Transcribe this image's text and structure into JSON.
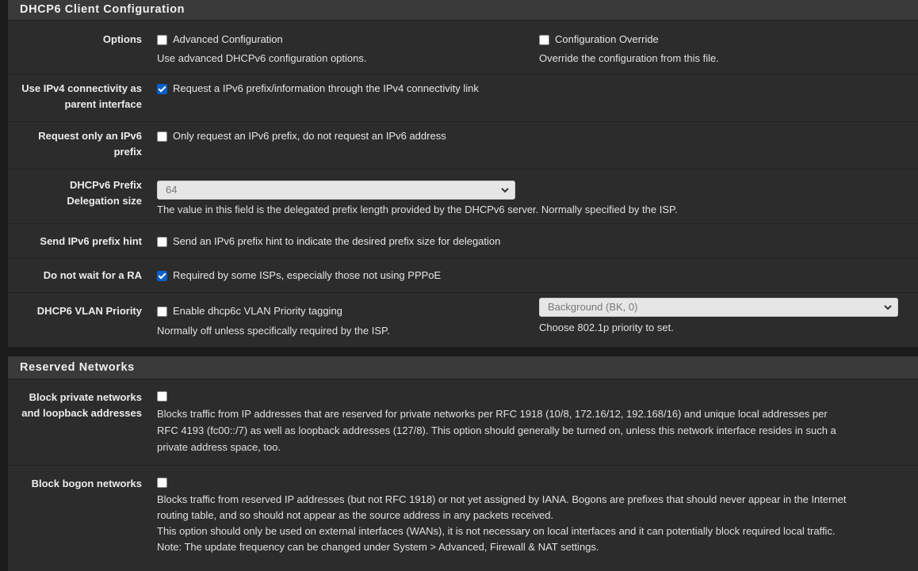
{
  "dhcp6": {
    "title": "DHCP6 Client Configuration",
    "options": {
      "label": "Options",
      "advanced": {
        "label": "Advanced Configuration",
        "checked": false,
        "help": "Use advanced DHCPv6 configuration options."
      },
      "override": {
        "label": "Configuration Override",
        "checked": false,
        "help": "Override the configuration from this file."
      }
    },
    "use_ipv4": {
      "label_line1": "Use IPv4 connectivity as",
      "label_line2": "parent interface",
      "text": "Request a IPv6 prefix/information through the IPv4 connectivity link",
      "checked": true
    },
    "request_only": {
      "label_line1": "Request only an IPv6",
      "label_line2": "prefix",
      "text": "Only request an IPv6 prefix, do not request an IPv6 address",
      "checked": false
    },
    "prefix_size": {
      "label_line1": "DHCPv6 Prefix",
      "label_line2": "Delegation size",
      "value": "64",
      "help": "The value in this field is the delegated prefix length provided by the DHCPv6 server. Normally specified by the ISP."
    },
    "prefix_hint": {
      "label": "Send IPv6 prefix hint",
      "text": "Send an IPv6 prefix hint to indicate the desired prefix size for delegation",
      "checked": false
    },
    "no_wait_ra": {
      "label": "Do not wait for a RA",
      "text": "Required by some ISPs, especially those not using PPPoE",
      "checked": true
    },
    "vlan_priority": {
      "label": "DHCP6 VLAN Priority",
      "text": "Enable dhcp6c VLAN Priority tagging",
      "checked": false,
      "help": "Normally off unless specifically required by the ISP.",
      "select_value": "Background (BK, 0)",
      "select_help": "Choose 802.1p priority to set."
    }
  },
  "reserved": {
    "title": "Reserved Networks",
    "block_private": {
      "label_line1": "Block private networks",
      "label_line2": "and loopback addresses",
      "checked": false,
      "help_lines": [
        "Blocks traffic from IP addresses that are reserved for private networks per RFC 1918 (10/8, 172.16/12, 192.168/16) and unique local addresses per",
        "RFC 4193 (fc00::/7) as well as loopback addresses (127/8). This option should generally be turned on, unless this network interface resides in such a",
        "private address space, too."
      ]
    },
    "block_bogon": {
      "label": "Block bogon networks",
      "checked": false,
      "help_lines": [
        "Blocks traffic from reserved IP addresses (but not RFC 1918) or not yet assigned by IANA. Bogons are prefixes that should never appear in the Internet",
        "routing table, and so should not appear as the source address in any packets received.",
        "This option should only be used on external interfaces (WANs), it is not necessary on local interfaces and it can potentially block required local traffic.",
        "Note: The update frequency can be changed under System > Advanced, Firewall & NAT settings."
      ]
    }
  }
}
